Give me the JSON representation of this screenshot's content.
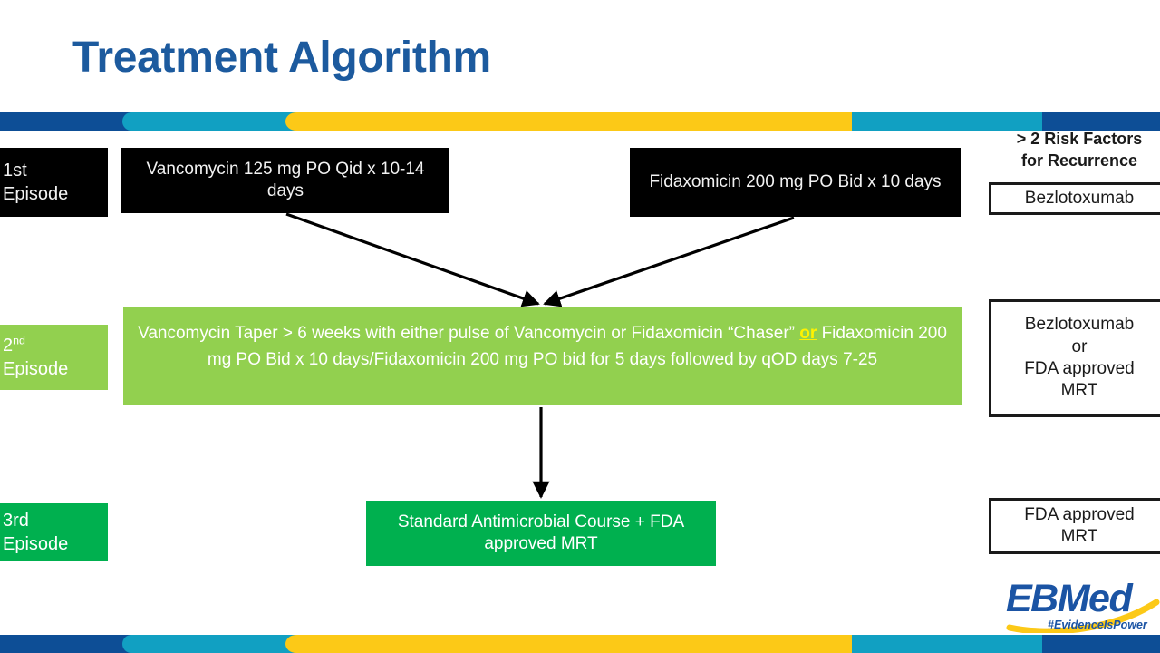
{
  "slide": {
    "title": "Treatment Algorithm"
  },
  "colors": {
    "title_blue": "#1C5A9E",
    "bar_navy": "#0D4E96",
    "bar_teal": "#11A0C2",
    "bar_yellow": "#FCC917",
    "box_black": "#000000",
    "box_light_green": "#92D04F",
    "box_dark_green": "#00B04F",
    "highlight_yellow": "#FFF200",
    "logo_blue": "#1B54A4"
  },
  "rows": {
    "first_episode": {
      "label_line1": "1st",
      "label_line2": "Episode",
      "treatment_left": "Vancomycin 125 mg PO Qid x 10-14 days",
      "treatment_right": "Fidaxomicin 200 mg PO Bid x 10 days"
    },
    "second_episode": {
      "label_number": "2",
      "label_ordinal": "nd",
      "label_line2": "Episode",
      "treatment_part1": "Vancomycin Taper > 6 weeks with either pulse of Vancomycin or Fidaxomicin “Chaser” ",
      "treatment_or": "or",
      "treatment_part2": " Fidaxomicin 200 mg PO Bid x 10 days/Fidaxomicin 200 mg PO bid for 5 days followed by qOD days 7-25"
    },
    "third_episode": {
      "label_line1": "3rd",
      "label_line2": "Episode",
      "treatment": "Standard Antimicrobial Course + FDA approved MRT"
    }
  },
  "risk_column": {
    "header_line1": "> 2 Risk Factors",
    "header_line2": "for Recurrence",
    "first_episode_option": "Bezlotoxumab",
    "second_episode_option": "Bezlotoxumab\nor\nFDA approved\nMRT",
    "third_episode_option": "FDA approved\nMRT"
  },
  "logo": {
    "wordmark": "EBMed",
    "tagline": "#EvidenceIsPower"
  }
}
